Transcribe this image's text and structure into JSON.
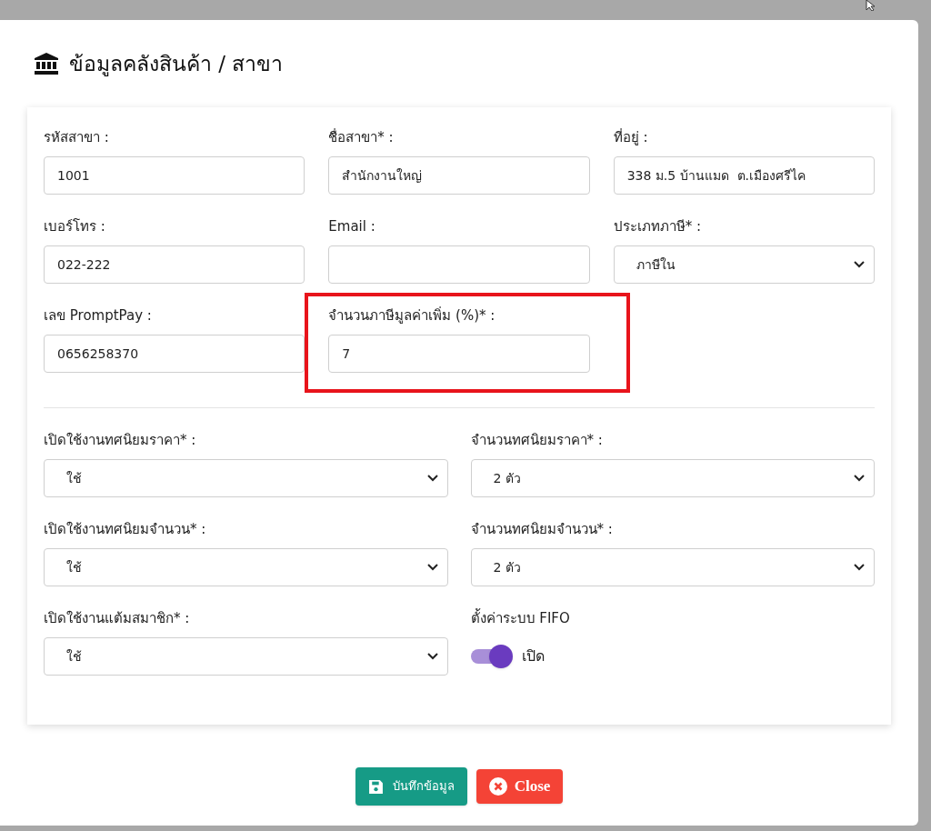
{
  "dialog": {
    "title": "ข้อมูลคลังสินค้า / สาขา",
    "sections": [
      {
        "fields": [
          {
            "label": "รหัสสาขา :",
            "kind": "input",
            "value": "1001"
          },
          {
            "label": "ชื่อสาขา* :",
            "kind": "input",
            "value": "สำนักงานใหญ่"
          },
          {
            "label": "ที่อยู่ :",
            "kind": "input",
            "value": "338 ม.5 บ้านแมด  ต.เมืองศรีไค"
          },
          {
            "label": "เบอร์โทร :",
            "kind": "input",
            "value": "022-222"
          },
          {
            "label": "Email :",
            "kind": "input"
          },
          {
            "label": "ประเภทภาษี* :",
            "kind": "select",
            "value": "ภาษีใน"
          },
          {
            "label": "เลข PromptPay :",
            "kind": "input",
            "value": "0656258370"
          },
          {
            "label": "จำนวนภาษีมูลค่าเพิ่ม (%)* :",
            "kind": "input",
            "value": "7",
            "highlighted": true
          }
        ]
      },
      {
        "fields": [
          {
            "label": "เปิดใช้งานทศนิยมราคา* :",
            "kind": "select",
            "value": "ใช้"
          },
          {
            "label": "จำนวนทศนิยมราคา* :",
            "kind": "select",
            "value": "2 ตัว"
          },
          {
            "label": "เปิดใช้งานทศนิยมจำนวน* :",
            "kind": "select",
            "value": "ใช้"
          },
          {
            "label": "จำนวนทศนิยมจำนวน* :",
            "kind": "select",
            "value": "2 ตัว"
          },
          {
            "label": "เปิดใช้งานแต้มสมาชิก* :",
            "kind": "select",
            "value": "ใช้"
          },
          {
            "label": "ตั้งค่าระบบ FIFO",
            "kind": "toggle",
            "on": true,
            "state_label": "เปิด"
          }
        ]
      }
    ],
    "buttons": [
      {
        "kind": "save",
        "label": "บันทึกข้อมูล"
      },
      {
        "kind": "close",
        "label": "Close"
      }
    ]
  }
}
